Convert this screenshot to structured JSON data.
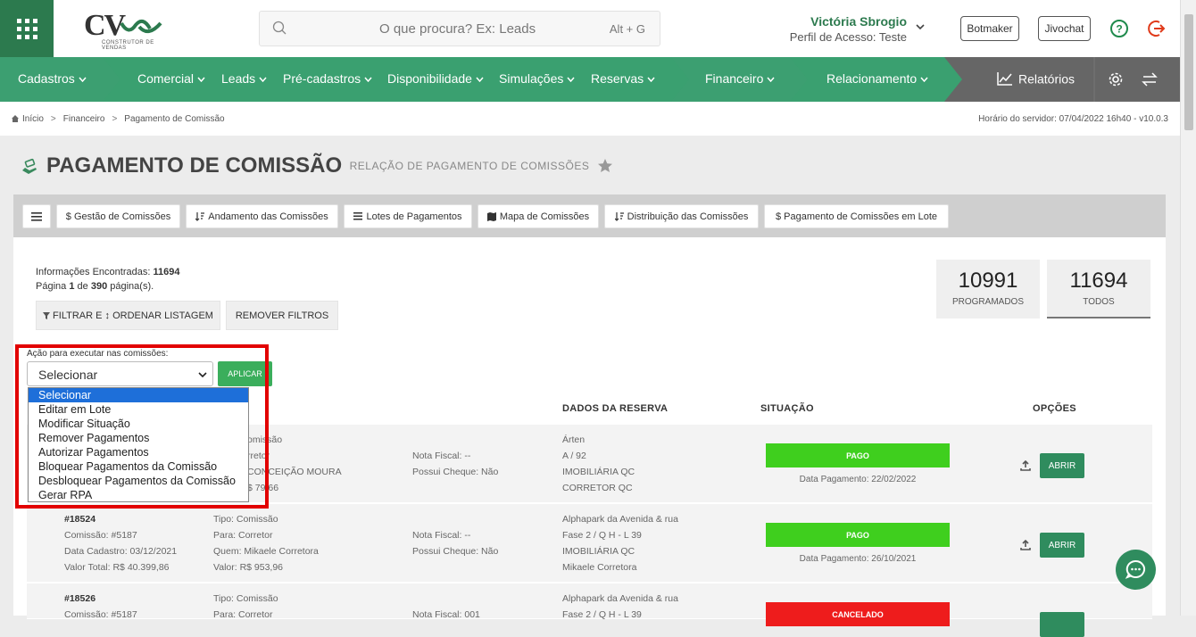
{
  "header": {
    "logo_text": "CV",
    "logo_sub": "CONSTRUTOR DE VENDAS",
    "search_placeholder": "O que procura? Ex: Leads",
    "search_shortcut": "Alt + G",
    "user_name": "Victória Sbrogio",
    "user_profile": "Perfil de Acesso: Teste",
    "botmaker": "Botmaker",
    "jivochat": "Jivochat"
  },
  "nav": {
    "items": [
      "Cadastros",
      "Comercial",
      "Leads",
      "Pré-cadastros",
      "Disponibilidade",
      "Simulações",
      "Reservas",
      "Financeiro",
      "Relacionamento"
    ],
    "relatorios": "Relatórios"
  },
  "breadcrumb": {
    "items": [
      "Início",
      "Financeiro",
      "Pagamento de Comissão"
    ],
    "server_time": "Horário do servidor: 07/04/2022 16h40 - v10.0.3"
  },
  "page": {
    "title": "PAGAMENTO DE COMISSÃO",
    "subtitle": "RELAÇÃO DE PAGAMENTO DE COMISSÕES"
  },
  "tabs": [
    "$ Gestão de Comissões",
    "Andamento das Comissões",
    "Lotes de Pagamentos",
    "Mapa de Comissões",
    "Distribuição das Comissões",
    "$ Pagamento de Comissões em Lote"
  ],
  "info": {
    "found_label": "Informações Encontradas:",
    "found_value": "11694",
    "page_prefix": "Página",
    "page_current": "1",
    "page_mid": "de",
    "page_total": "390",
    "page_suffix": "página(s)."
  },
  "filters": {
    "filter_btn": "FILTRAR E ↕ ORDENAR LISTAGEM",
    "remove_btn": "REMOVER FILTROS"
  },
  "stats": [
    {
      "value": "10991",
      "label": "PROGRAMADOS"
    },
    {
      "value": "11694",
      "label": "TODOS"
    }
  ],
  "action": {
    "label": "Ação para executar nas comissões:",
    "selected": "Selecionar",
    "apply": "APLICAR",
    "options": [
      "Selecionar",
      "Editar em Lote",
      "Modificar Situação",
      "Remover Pagamentos",
      "Autorizar Pagamentos",
      "Bloquear Pagamentos da Comissão",
      "Desbloquear Pagamentos da Comissão",
      "Gerar RPA"
    ]
  },
  "table": {
    "headers": [
      "DADOS DA RESERVA",
      "SITUAÇÃO",
      "OPÇÕES"
    ],
    "open_label": "ABRIR",
    "rows": [
      {
        "c1": [
          "",
          "",
          "",
          ""
        ],
        "c2": [
          "omissão",
          "rretor",
          "CONCEIÇÃO MOURA",
          "$ 79,66"
        ],
        "c3": [
          "Nota Fiscal: --",
          "Possui Cheque: Não"
        ],
        "c4": [
          "Árten",
          "A / 92",
          "IMOBILIÁRIA QC",
          "CORRETOR QC"
        ],
        "status": "PAGO",
        "status_color": "#3fcf1e",
        "date": "Data Pagamento: 22/02/2022"
      },
      {
        "c1": [
          "#18524",
          "Comissão: #5187",
          "Data Cadastro: 03/12/2021",
          "Valor Total: R$ 40.399,86"
        ],
        "c2": [
          "Tipo: Comissão",
          "Para: Corretor",
          "Quem: Mikaele Corretora",
          "Valor: R$ 953,96"
        ],
        "c3": [
          "Nota Fiscal: --",
          "Possui Cheque: Não"
        ],
        "c4": [
          "Alphapark da Avenida & rua",
          "Fase 2 / Q H - L 39",
          "IMOBILIÁRIA QC",
          "Mikaele Corretora"
        ],
        "status": "PAGO",
        "status_color": "#3fcf1e",
        "date": "Data Pagamento: 26/10/2021"
      },
      {
        "c1": [
          "#18526",
          "Comissão: #5187",
          "",
          ""
        ],
        "c2": [
          "Tipo: Comissão",
          "Para: Corretor",
          "",
          ""
        ],
        "c3": [
          "Nota Fiscal: 001",
          ""
        ],
        "c4": [
          "Alphapark da Avenida & rua",
          "Fase 2 / Q H - L 39",
          "",
          ""
        ],
        "status": "CANCELADO",
        "status_color": "#ee1c1c",
        "date": ""
      }
    ]
  }
}
